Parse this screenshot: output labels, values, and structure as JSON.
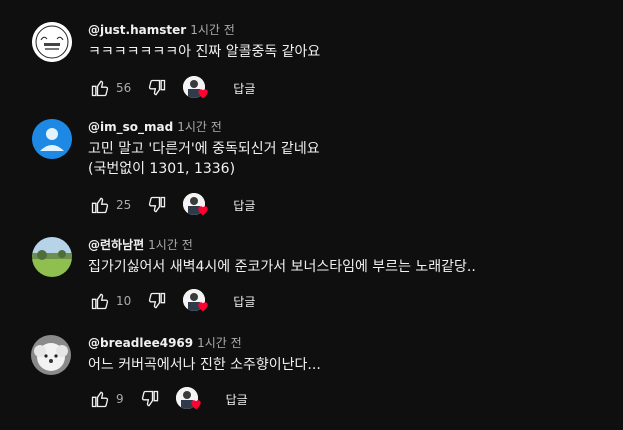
{
  "comments": [
    {
      "author": "@just.hamster",
      "time": "1시간 전",
      "lines": [
        "ㅋㅋㅋㅋㅋㅋㅋ아 진짜 알콜중독 같아요"
      ],
      "likes": "56",
      "reply_label": "답글",
      "avatar_icon": "hamster-badge-icon"
    },
    {
      "author": "@im_so_mad",
      "time": "1시간 전",
      "lines": [
        "고민 말고 '다른거'에 중독되신거 같네요",
        "(국번없이 1301, 1336)"
      ],
      "likes": "25",
      "reply_label": "답글",
      "avatar_icon": "default-user-icon"
    },
    {
      "author": "@련하남편",
      "time": "1시간 전",
      "lines": [
        "집가기싫어서 새벽4시에 준코가서 보너스타임에 부르는 노래같당.."
      ],
      "likes": "10",
      "reply_label": "답글",
      "avatar_icon": "landscape-photo-icon"
    },
    {
      "author": "@breadlee4969",
      "time": "1시간 전",
      "lines": [
        "어느 커버곡에서나 진한 소주향이난다..."
      ],
      "likes": "9",
      "reply_label": "답글",
      "avatar_icon": "dog-photo-icon"
    }
  ],
  "colors": {
    "background": "#0f0f0f",
    "text": "#f1f1f1",
    "muted": "#aaaaaa",
    "heart": "#ff0033",
    "default_avatar": "#1e88e5"
  }
}
